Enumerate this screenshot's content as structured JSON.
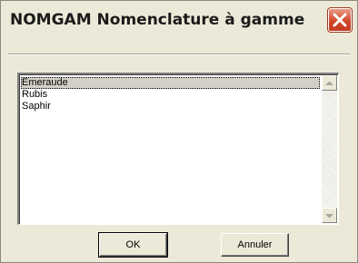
{
  "window": {
    "title": "NOMGAM Nomenclature à gamme"
  },
  "list": {
    "items": [
      "Emeraude",
      "Rubis",
      "Saphir"
    ],
    "selected_index": 0
  },
  "buttons": {
    "ok_label": "OK",
    "cancel_label": "Annuler"
  },
  "icons": {
    "close": "close-icon",
    "scroll_up": "arrow-up-icon",
    "scroll_down": "arrow-down-icon"
  },
  "colors": {
    "dialog_bg": "#ece9d8",
    "close_red": "#d2492e",
    "selection_bg": "#d4d0c8"
  }
}
